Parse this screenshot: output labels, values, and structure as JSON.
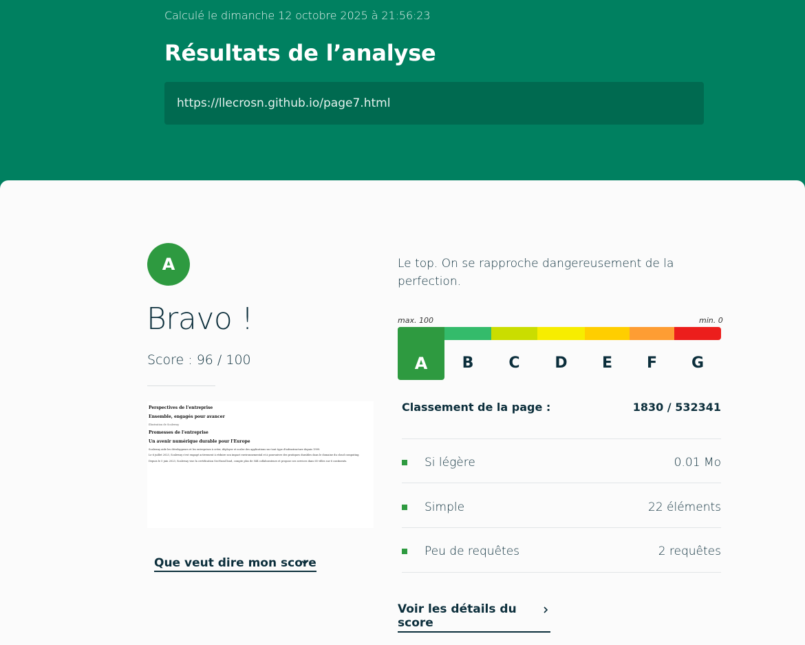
{
  "header": {
    "calc_date": "Calculé le dimanche 12 octobre 2025 à 21:56:23",
    "title": "Résultats de l’analyse",
    "url": "https://llecrosn.github.io/page7.html"
  },
  "result": {
    "grade": "A",
    "headline": "Bravo !",
    "score_text": "Score : 96 / 100",
    "score_value": 96,
    "score_max": 100,
    "score_link": "Que veut dire mon score",
    "description": "Le top. On se rapproche dangereusement de la perfection."
  },
  "thumbnail": {
    "h1": "Perspectives de l'entreprise",
    "h2": "Ensemble, engagés pour avancer",
    "img_alt": "Illustration de Scaleway",
    "h3": "Promesses de l'entreprise",
    "h4": "Un avenir numérique durable pour l'Europe",
    "p1": "Scaleway aide les développeurs et les entreprises à créer, déployer et scaler des applications sur tout type d'infrastructure depuis 1999.",
    "p2": "Le 6 juillet 2023, Scaleway s'est engagé activement à réduire son impact environnemental et à poursuivre des pratiques durables dans le domaine du cloud computing.",
    "p3": "Depuis le 5 juin 2023, Scaleway vise la certification SecNumCloud, compte plus de 544 collaborateurs et propose ses services dans 65 villes sur 6 continents."
  },
  "scale": {
    "max_label": "max. 100",
    "min_label": "min. 0",
    "active": "A",
    "grades": [
      {
        "letter": "A",
        "color": "#2e9a40"
      },
      {
        "letter": "B",
        "color": "#34bb6b"
      },
      {
        "letter": "C",
        "color": "#cadd00"
      },
      {
        "letter": "D",
        "color": "#f7ed00"
      },
      {
        "letter": "E",
        "color": "#ffce00"
      },
      {
        "letter": "F",
        "color": "#fe9d33"
      },
      {
        "letter": "G",
        "color": "#ec1e1c"
      }
    ]
  },
  "ranking": {
    "label": "Classement de la page :",
    "value": "1830 / 532341"
  },
  "metrics": [
    {
      "label": "Si légère",
      "value": "0.01 Mo"
    },
    {
      "label": "Simple",
      "value": "22 éléments"
    },
    {
      "label": "Peu de requêtes",
      "value": "2 requêtes"
    }
  ],
  "details_link": "Voir les détails du score",
  "colors": {
    "header_bg": "#008060",
    "url_box_bg": "#006a50",
    "accent": "#2e9a40",
    "text_dark": "#0b2e3b"
  },
  "icons": {
    "score_toggle": "chevron-down-icon",
    "details_link": "chevron-right-icon"
  }
}
